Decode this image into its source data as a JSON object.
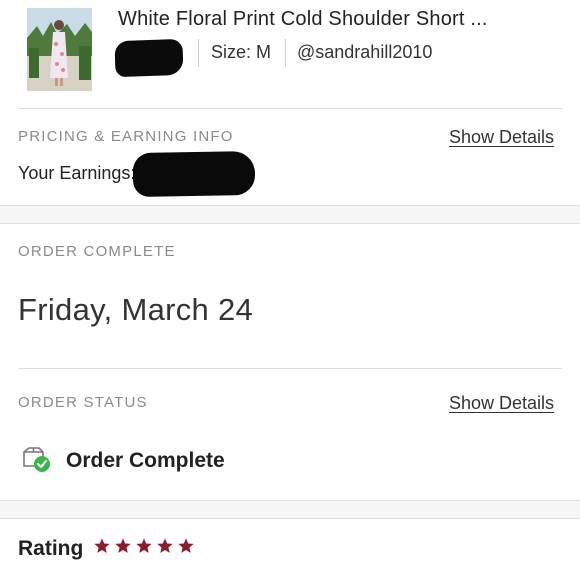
{
  "item": {
    "title": "White Floral Print Cold Shoulder Short ...",
    "size_label": "Size: M",
    "seller": "@sandrahill2010"
  },
  "pricing": {
    "section_label": "PRICING & EARNING INFO",
    "show_details": "Show Details",
    "earnings_label": "Your Earnings: $"
  },
  "order_complete": {
    "section_label": "ORDER COMPLETE",
    "date": "Friday, March 24"
  },
  "order_status": {
    "section_label": "ORDER STATUS",
    "show_details": "Show Details",
    "status": "Order Complete",
    "icon": "package-check-icon"
  },
  "rating": {
    "label": "Rating",
    "stars": 5,
    "max_stars": 5,
    "star_color": "#8b1c2b"
  },
  "colors": {
    "check_green": "#3bb54a",
    "star": "#8b1c2b"
  }
}
